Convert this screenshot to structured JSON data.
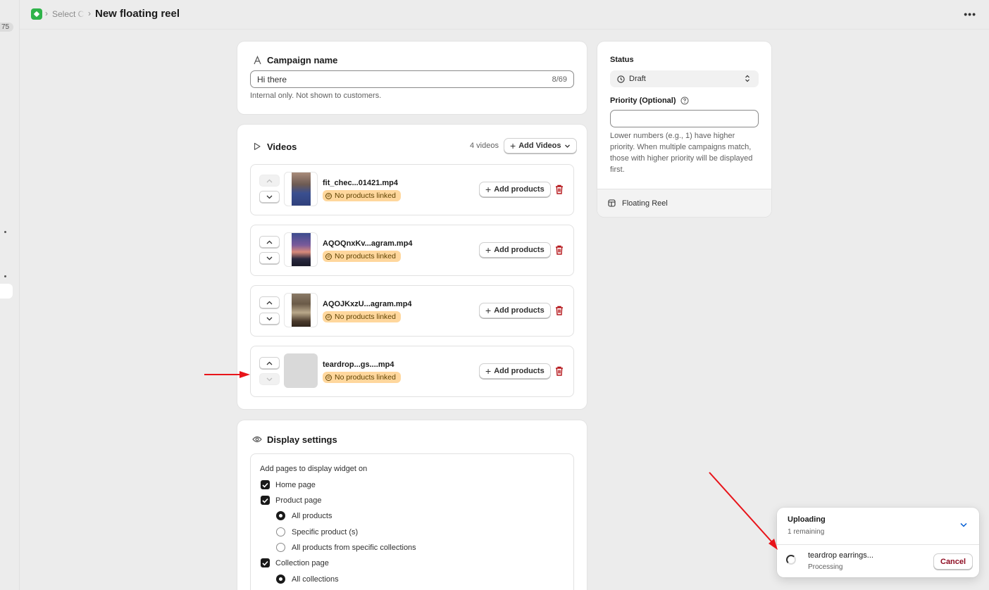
{
  "rail": {
    "badge": "75"
  },
  "header": {
    "breadcrumb": "Select C",
    "title": "New floating reel",
    "more": "•••"
  },
  "campaign": {
    "heading": "Campaign name",
    "value": "Hi there",
    "counter": "8/69",
    "help": "Internal only. Not shown to customers."
  },
  "videos": {
    "heading": "Videos",
    "count": "4 videos",
    "add_label": "Add Videos",
    "add_products_label": "Add products",
    "badge": "No products linked",
    "items": [
      {
        "name": "fit_chec...01421.mp4"
      },
      {
        "name": "AQOQnxKv...agram.mp4"
      },
      {
        "name": "AQOJKxzU...agram.mp4"
      },
      {
        "name": "teardrop...gs....mp4"
      }
    ]
  },
  "display": {
    "heading": "Display settings",
    "intro": "Add pages to display widget on",
    "home": "Home page",
    "product": "Product page",
    "product_opts": [
      "All products",
      "Specific product (s)",
      "All products from specific collections"
    ],
    "collection": "Collection page",
    "collection_opts": [
      "All collections"
    ]
  },
  "status": {
    "heading": "Status",
    "value": "Draft",
    "priority_label": "Priority (Optional)",
    "priority_value": "",
    "help": "Lower numbers (e.g., 1) have higher priority. When multiple campaigns match, those with higher priority will be displayed first.",
    "footer": "Floating Reel"
  },
  "upload": {
    "title": "Uploading",
    "remaining": "1 remaining",
    "file": "teardrop earrings...",
    "state": "Processing",
    "cancel": "Cancel"
  },
  "colors": {
    "accent_green": "#2fb34a",
    "badge_bg": "#ffd79d",
    "danger": "#b5171b",
    "annotation": "#e8141a"
  }
}
